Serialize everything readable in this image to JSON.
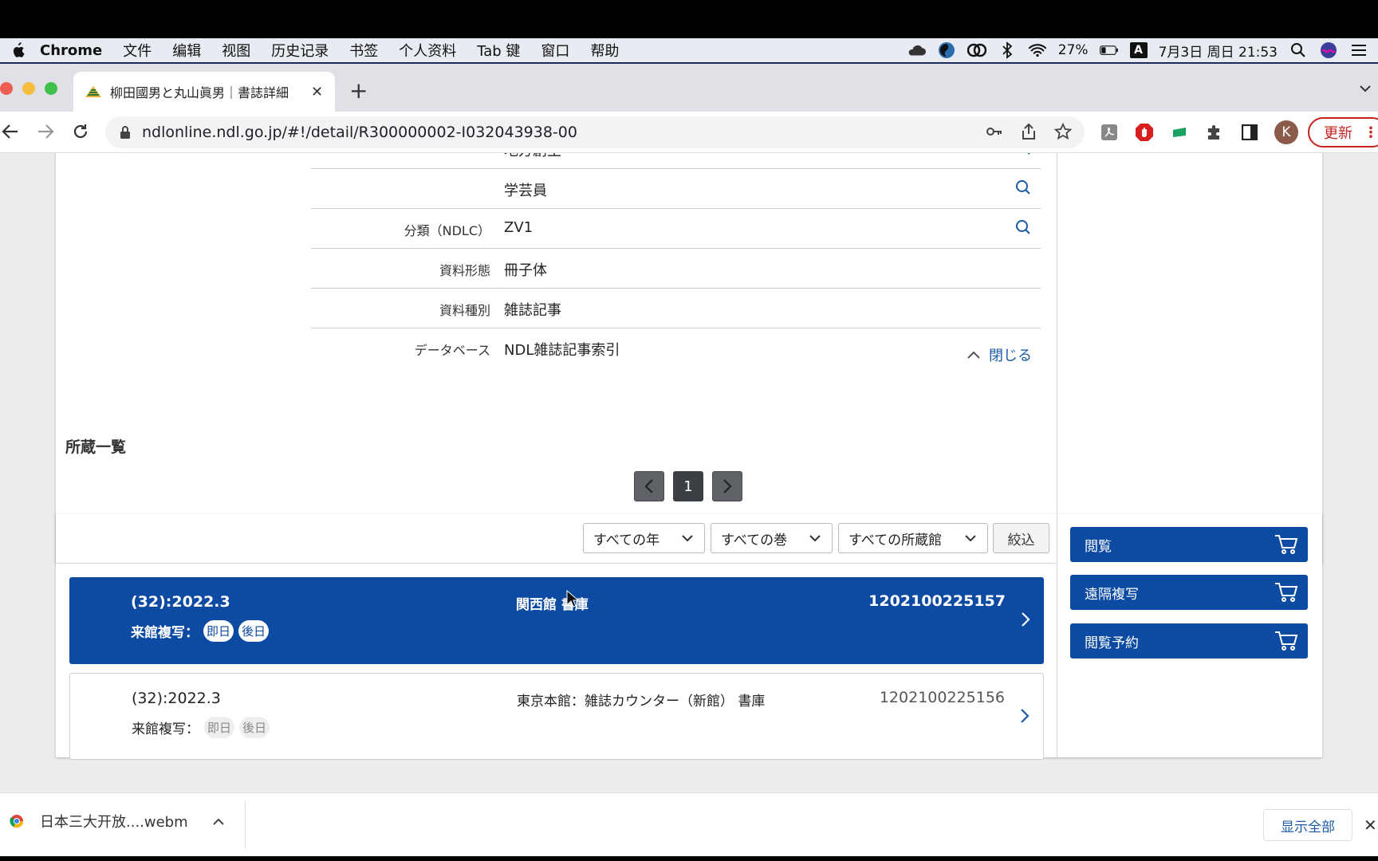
{
  "menubar": {
    "app": "Chrome",
    "items": [
      "文件",
      "编辑",
      "视图",
      "历史记录",
      "书签",
      "个人资料",
      "Tab 键",
      "窗口",
      "帮助"
    ],
    "battery": "27%",
    "input_method": "A",
    "datetime": "7月3日 周日 21:53"
  },
  "browser": {
    "tab_title": "柳田國男と丸山眞男｜書誌詳細",
    "url": "ndlonline.ndl.go.jp/#!/detail/R300000002-I032043938-00",
    "avatar_letter": "K",
    "update_label": "更新"
  },
  "details": {
    "rows": [
      {
        "label": "",
        "value": "地方創生",
        "search": true
      },
      {
        "label": "",
        "value": "学芸員",
        "search": true
      },
      {
        "label": "分類（NDLC）",
        "value": "ZV1",
        "search": true
      },
      {
        "label": "資料形態",
        "value": "冊子体",
        "search": false
      },
      {
        "label": "資料種別",
        "value": "雑誌記事",
        "search": false
      },
      {
        "label": "データベース",
        "value": "NDL雑誌記事索引",
        "search": false
      }
    ],
    "close_label": "閉じる"
  },
  "holdings": {
    "title": "所蔵一覧",
    "page": "1",
    "filters": {
      "year": "すべての年",
      "volume": "すべての巻",
      "library": "すべての所蔵館",
      "apply": "絞込"
    },
    "items": [
      {
        "volume": "(32):2022.3",
        "location": "関西館 書庫",
        "code": "1202100225157",
        "copy_label": "来館複写：",
        "pills": [
          "即日",
          "後日"
        ]
      },
      {
        "volume": "(32):2022.3",
        "location": "東京本館：雑誌カウンター（新館） 書庫",
        "code": "1202100225156",
        "copy_label": "来館複写：",
        "pills": [
          "即日",
          "後日"
        ]
      }
    ],
    "actions": [
      "閲覧",
      "遠隔複写",
      "閲覧予約"
    ]
  },
  "download": {
    "file": "日本三大开放....webm",
    "show_all": "显示全部"
  }
}
